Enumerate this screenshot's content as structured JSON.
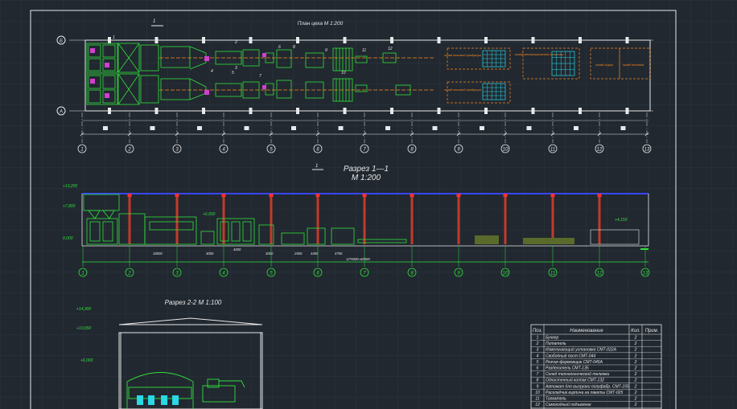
{
  "drawing": {
    "plan_title": "План цеха М 1:200",
    "section1_title": "Разрез 1—1",
    "section1_scale": "М 1:200",
    "section2_title": "Разрез 2-2  М 1:100",
    "section_mark": "1",
    "axis_rows": [
      "Б",
      "А"
    ],
    "axis_cols": [
      "1",
      "2",
      "3",
      "4",
      "5",
      "6",
      "7",
      "8",
      "9",
      "10",
      "11",
      "12",
      "13"
    ],
    "elevations_s1": [
      "+13,200",
      "+7,800",
      "0,000",
      "+6,000",
      "+4,150"
    ],
    "elevations_s2": [
      "+14,300",
      "+10,650",
      "+6,000"
    ],
    "plan_zone_labels": [
      "склад готовой продукции",
      "склад готовой продукции",
      "склад технологической оснастки",
      "склад сырья",
      "склад отходов"
    ],
    "plan_numbers": [
      "1",
      "2",
      "3",
      "4",
      "5",
      "6",
      "7",
      "8",
      "9",
      "10",
      "11",
      "12"
    ],
    "dimensions_s1": [
      "18000",
      "3000",
      "4000",
      "3000",
      "2500",
      "4450",
      "4750",
      "12*5000=60000"
    ]
  },
  "spec_table": {
    "headers": [
      "Поз.",
      "Наименование",
      "Кол.",
      "Прим."
    ],
    "rows": [
      [
        "1",
        "Бункер",
        "2",
        ""
      ],
      [
        "2",
        "Питатель",
        "2",
        ""
      ],
      [
        "3",
        "Измельчающий установка СМТ-022А",
        "2",
        ""
      ],
      [
        "4",
        "Свободный пост СМТ-044",
        "2",
        ""
      ],
      [
        "5",
        "Резчик-формовщик СМТ-045А",
        "2",
        ""
      ],
      [
        "6",
        "Разделитель СМТ-135",
        "2",
        ""
      ],
      [
        "7",
        "Склад технологической тележки",
        "2",
        ""
      ],
      [
        "8",
        "Одностенный колпак СМТ-132",
        "2",
        ""
      ],
      [
        "9",
        "Автомат для выгрузки полуфабр. СМТ-155",
        "2",
        ""
      ],
      [
        "10",
        "Раскладчик кирпича на пакеты СМТ-025",
        "2",
        ""
      ],
      [
        "11",
        "Толкатель",
        "2",
        ""
      ],
      [
        "12",
        "Самоходный подъемник",
        "2",
        ""
      ]
    ]
  }
}
